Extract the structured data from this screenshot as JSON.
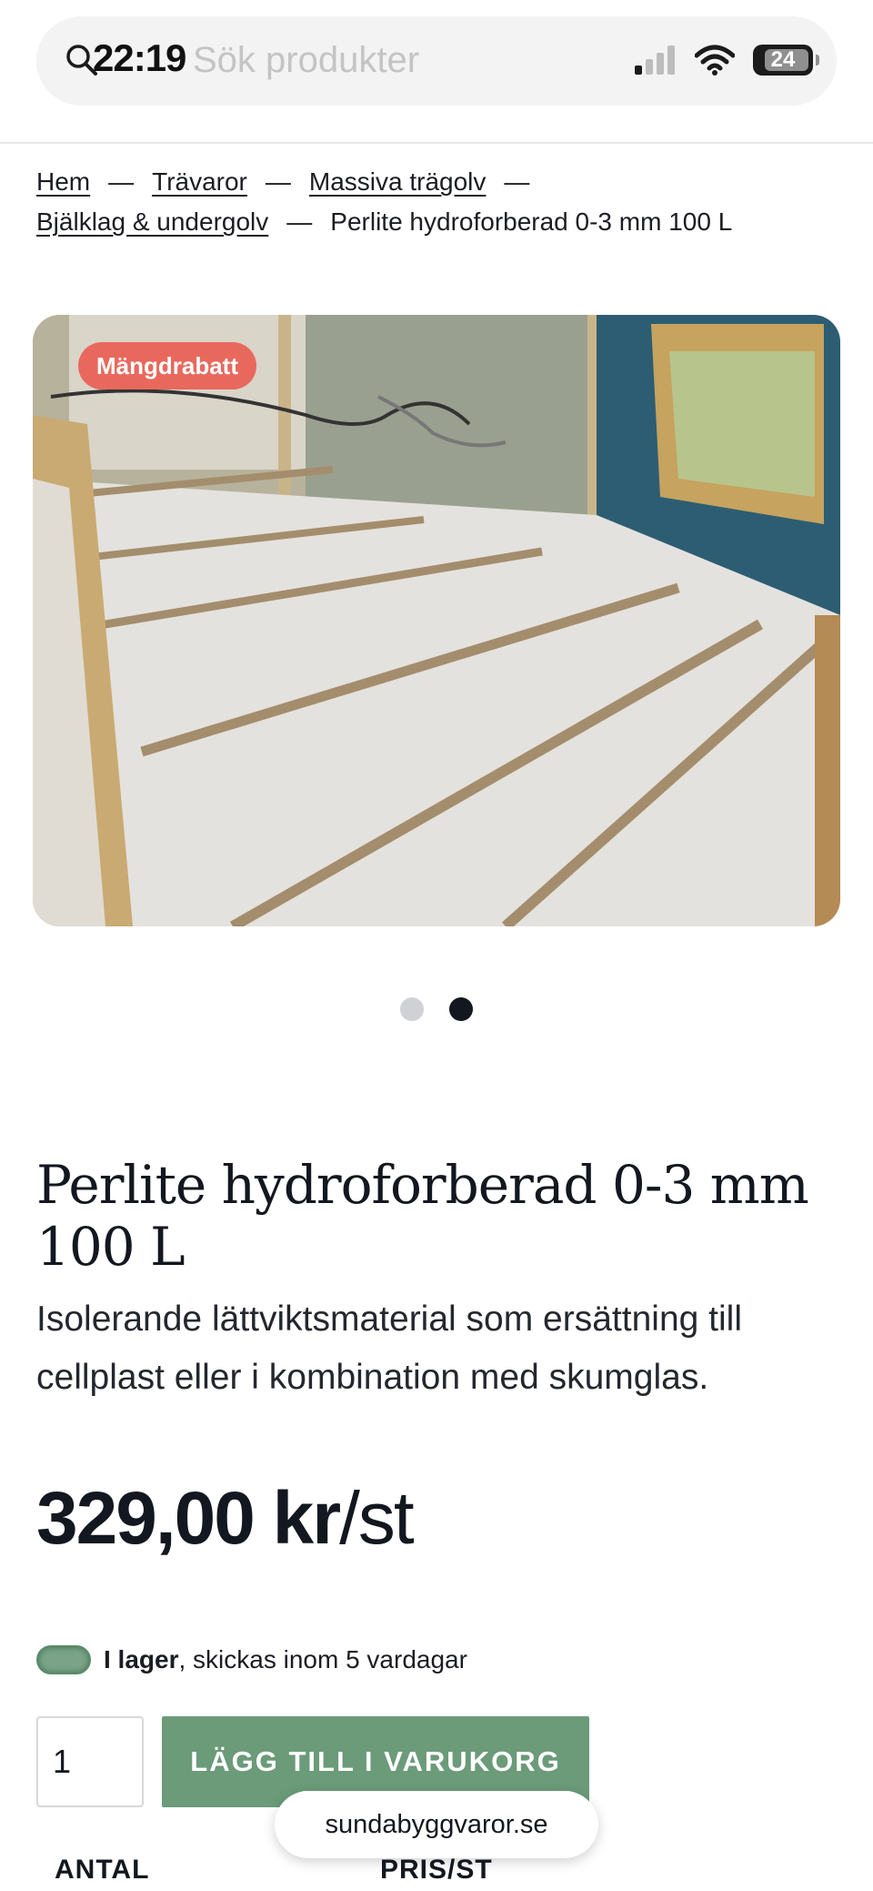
{
  "status_bar": {
    "time": "22:19",
    "battery": "24"
  },
  "search": {
    "placeholder": "Sök produkter"
  },
  "breadcrumb": {
    "items": [
      "Hem",
      "Trävaror",
      "Massiva trägolv",
      "Bjälklag & undergolv"
    ],
    "separator": "—",
    "current": "Perlite hydroforberad 0-3 mm 100 L"
  },
  "product": {
    "badge": "Mängdrabatt",
    "title": "Perlite hydroforberad 0-3 mm 100 L",
    "description": "Isolerande lättviktsmaterial som ersättning till cellplast eller i kombination med skumglas.",
    "price_amount": "329,00 kr",
    "price_unit": "/st",
    "stock_status": "I lager",
    "stock_detail": ", skickas inom 5 vardagar",
    "quantity": "1",
    "add_to_cart_label": "LÄGG TILL I VARUKORG"
  },
  "carousel": {
    "total": 2,
    "active": 2
  },
  "browser": {
    "url": "sundabyggvaror.se"
  },
  "table": {
    "headers": [
      "ANTAL",
      "PRIS/ST"
    ]
  },
  "colors": {
    "accent_green": "#6b9b79",
    "badge_red": "#e9685d",
    "text_dark": "#13171f"
  }
}
